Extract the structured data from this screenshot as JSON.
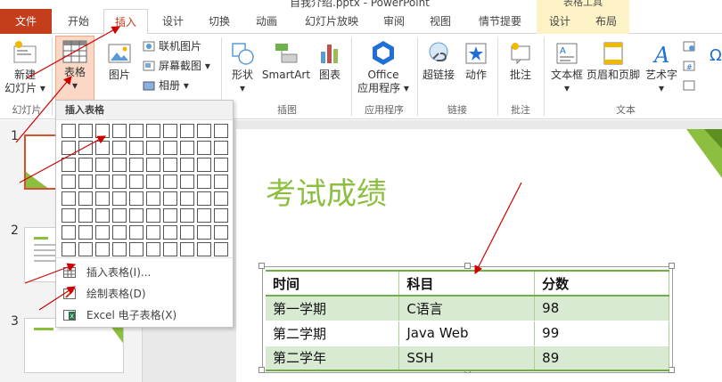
{
  "window": {
    "doc_title": "自我介绍.pptx - PowerPoint",
    "tools_title": "表格工具"
  },
  "tabs": [
    {
      "label": "文件"
    },
    {
      "label": "开始"
    },
    {
      "label": "插入"
    },
    {
      "label": "设计"
    },
    {
      "label": "切换"
    },
    {
      "label": "动画"
    },
    {
      "label": "幻灯片放映"
    },
    {
      "label": "审阅"
    },
    {
      "label": "视图"
    },
    {
      "label": "情节提要"
    },
    {
      "label": "设计"
    },
    {
      "label": "布局"
    }
  ],
  "ribbon": {
    "new_slide": "新建\n幻灯片",
    "new_slide_l1": "新建",
    "new_slide_l2": "幻灯片 ▾",
    "table_l1": "表格",
    "table_l2": "▾",
    "picture": "图片",
    "online_picture": "联机图片",
    "screenshot": "屏幕截图 ▾",
    "album": "相册 ▾",
    "shapes_l1": "形状",
    "shapes_l2": "▾",
    "smartart": "SmartArt",
    "chart": "图表",
    "office_apps_l1": "Office",
    "office_apps_l2": "应用程序 ▾",
    "hyperlink": "超链接",
    "action": "动作",
    "comment": "批注",
    "textbox_l1": "文本框",
    "textbox_l2": "▾",
    "header_footer": "页眉和页脚",
    "wordart_l1": "艺术字",
    "wordart_l2": "▾",
    "groups": {
      "slides": "幻灯片",
      "illustrations": "插图",
      "apps": "应用程序",
      "links": "链接",
      "comments": "批注",
      "text": "文本"
    }
  },
  "dropdown": {
    "header": "插入表格",
    "items": [
      {
        "label": "插入表格(I)..."
      },
      {
        "label": "绘制表格(D)"
      },
      {
        "label": "Excel 电子表格(X)"
      }
    ]
  },
  "thumbs": [
    {
      "num": "1"
    },
    {
      "num": "2"
    },
    {
      "num": "3"
    }
  ],
  "slide": {
    "title": "考试成绩",
    "table": {
      "headers": [
        "时间",
        "科目",
        "分数"
      ],
      "rows": [
        [
          "第一学期",
          "C语言",
          "98"
        ],
        [
          "第二学期",
          "Java Web",
          "99"
        ],
        [
          "第二学年",
          "SSH",
          "89"
        ]
      ]
    }
  },
  "colors": {
    "accent": "#c43e1c",
    "title_green": "#8cbf3f",
    "table_green": "#70ad47",
    "band_green": "#d9ead3",
    "arrow_red": "#d00000"
  }
}
